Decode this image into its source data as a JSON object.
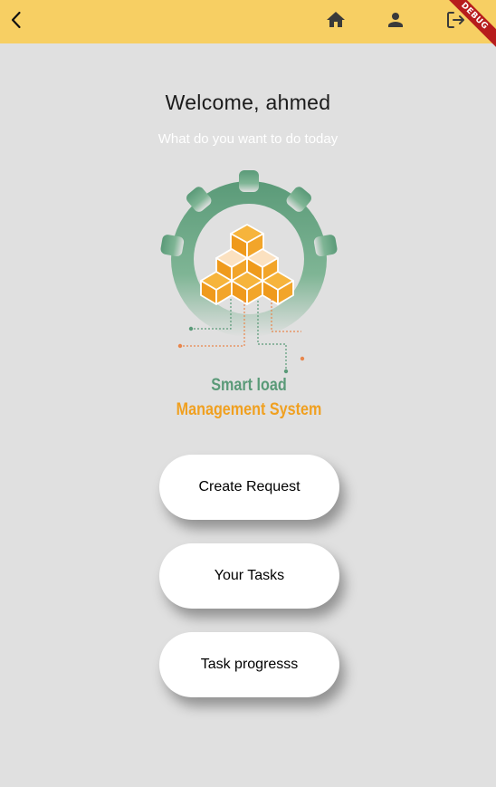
{
  "appbar": {
    "back_icon": "chevron-left-icon",
    "home_icon": "home-icon",
    "profile_icon": "person-icon",
    "logout_icon": "logout-icon",
    "background_color": "#f7cf63"
  },
  "debug_banner": {
    "label": "DEBUG",
    "color": "#b71c1c"
  },
  "main": {
    "welcome": "Welcome, ahmed",
    "subtitle": "What do you want to do today"
  },
  "logo": {
    "line1": "Smart load",
    "line2": "Management System",
    "primary_color": "#5a9a78",
    "accent_color": "#f0a020"
  },
  "actions": {
    "create_request": "Create Request",
    "your_tasks": "Your Tasks",
    "task_progress": "Task progresss"
  },
  "colors": {
    "background": "#e0e0e0",
    "button_background": "#ffffff"
  }
}
